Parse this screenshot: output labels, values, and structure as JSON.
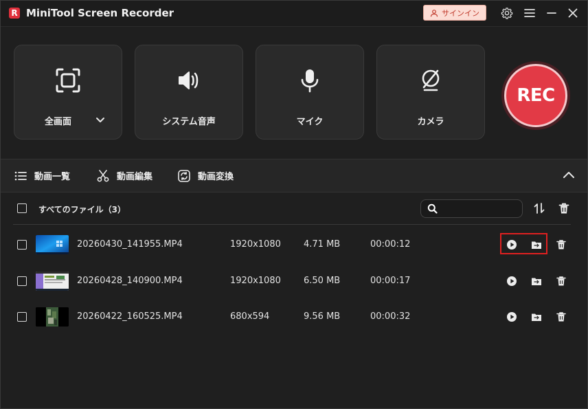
{
  "app": {
    "title": "MiniTool Screen Recorder",
    "logo_letter": "R",
    "signin_label": "サインイン"
  },
  "titlebar_icons": [
    "gear-icon",
    "menu-icon",
    "minimize-icon",
    "close-icon"
  ],
  "sources": [
    {
      "label": "全画面",
      "icon": "fullscreen-icon",
      "has_dropdown": true
    },
    {
      "label": "システム音声",
      "icon": "speaker-icon"
    },
    {
      "label": "マイク",
      "icon": "microphone-icon"
    },
    {
      "label": "カメラ",
      "icon": "camera-off-icon"
    }
  ],
  "rec_label": "REC",
  "tabs": [
    {
      "label": "動画一覧",
      "icon": "list-icon"
    },
    {
      "label": "動画編集",
      "icon": "scissors-icon"
    },
    {
      "label": "動画変換",
      "icon": "convert-icon"
    }
  ],
  "file_list": {
    "select_all_label": "すべてのファイル（3）",
    "search_value": "",
    "files": [
      {
        "name": "20260430_141955.MP4",
        "resolution": "1920x1080",
        "size": "4.71 MB",
        "duration": "00:00:12",
        "highlighted": true
      },
      {
        "name": "20260428_140900.MP4",
        "resolution": "1920x1080",
        "size": "6.50 MB",
        "duration": "00:00:17"
      },
      {
        "name": "20260422_160525.MP4",
        "resolution": "680x594",
        "size": "9.56 MB",
        "duration": "00:00:32"
      }
    ]
  },
  "colors": {
    "background": "#1f1f1f",
    "card": "#2a2a2a",
    "rec_red": "#e23a46",
    "signin_bg": "#fcdcd4",
    "highlight_border": "#e02020"
  }
}
